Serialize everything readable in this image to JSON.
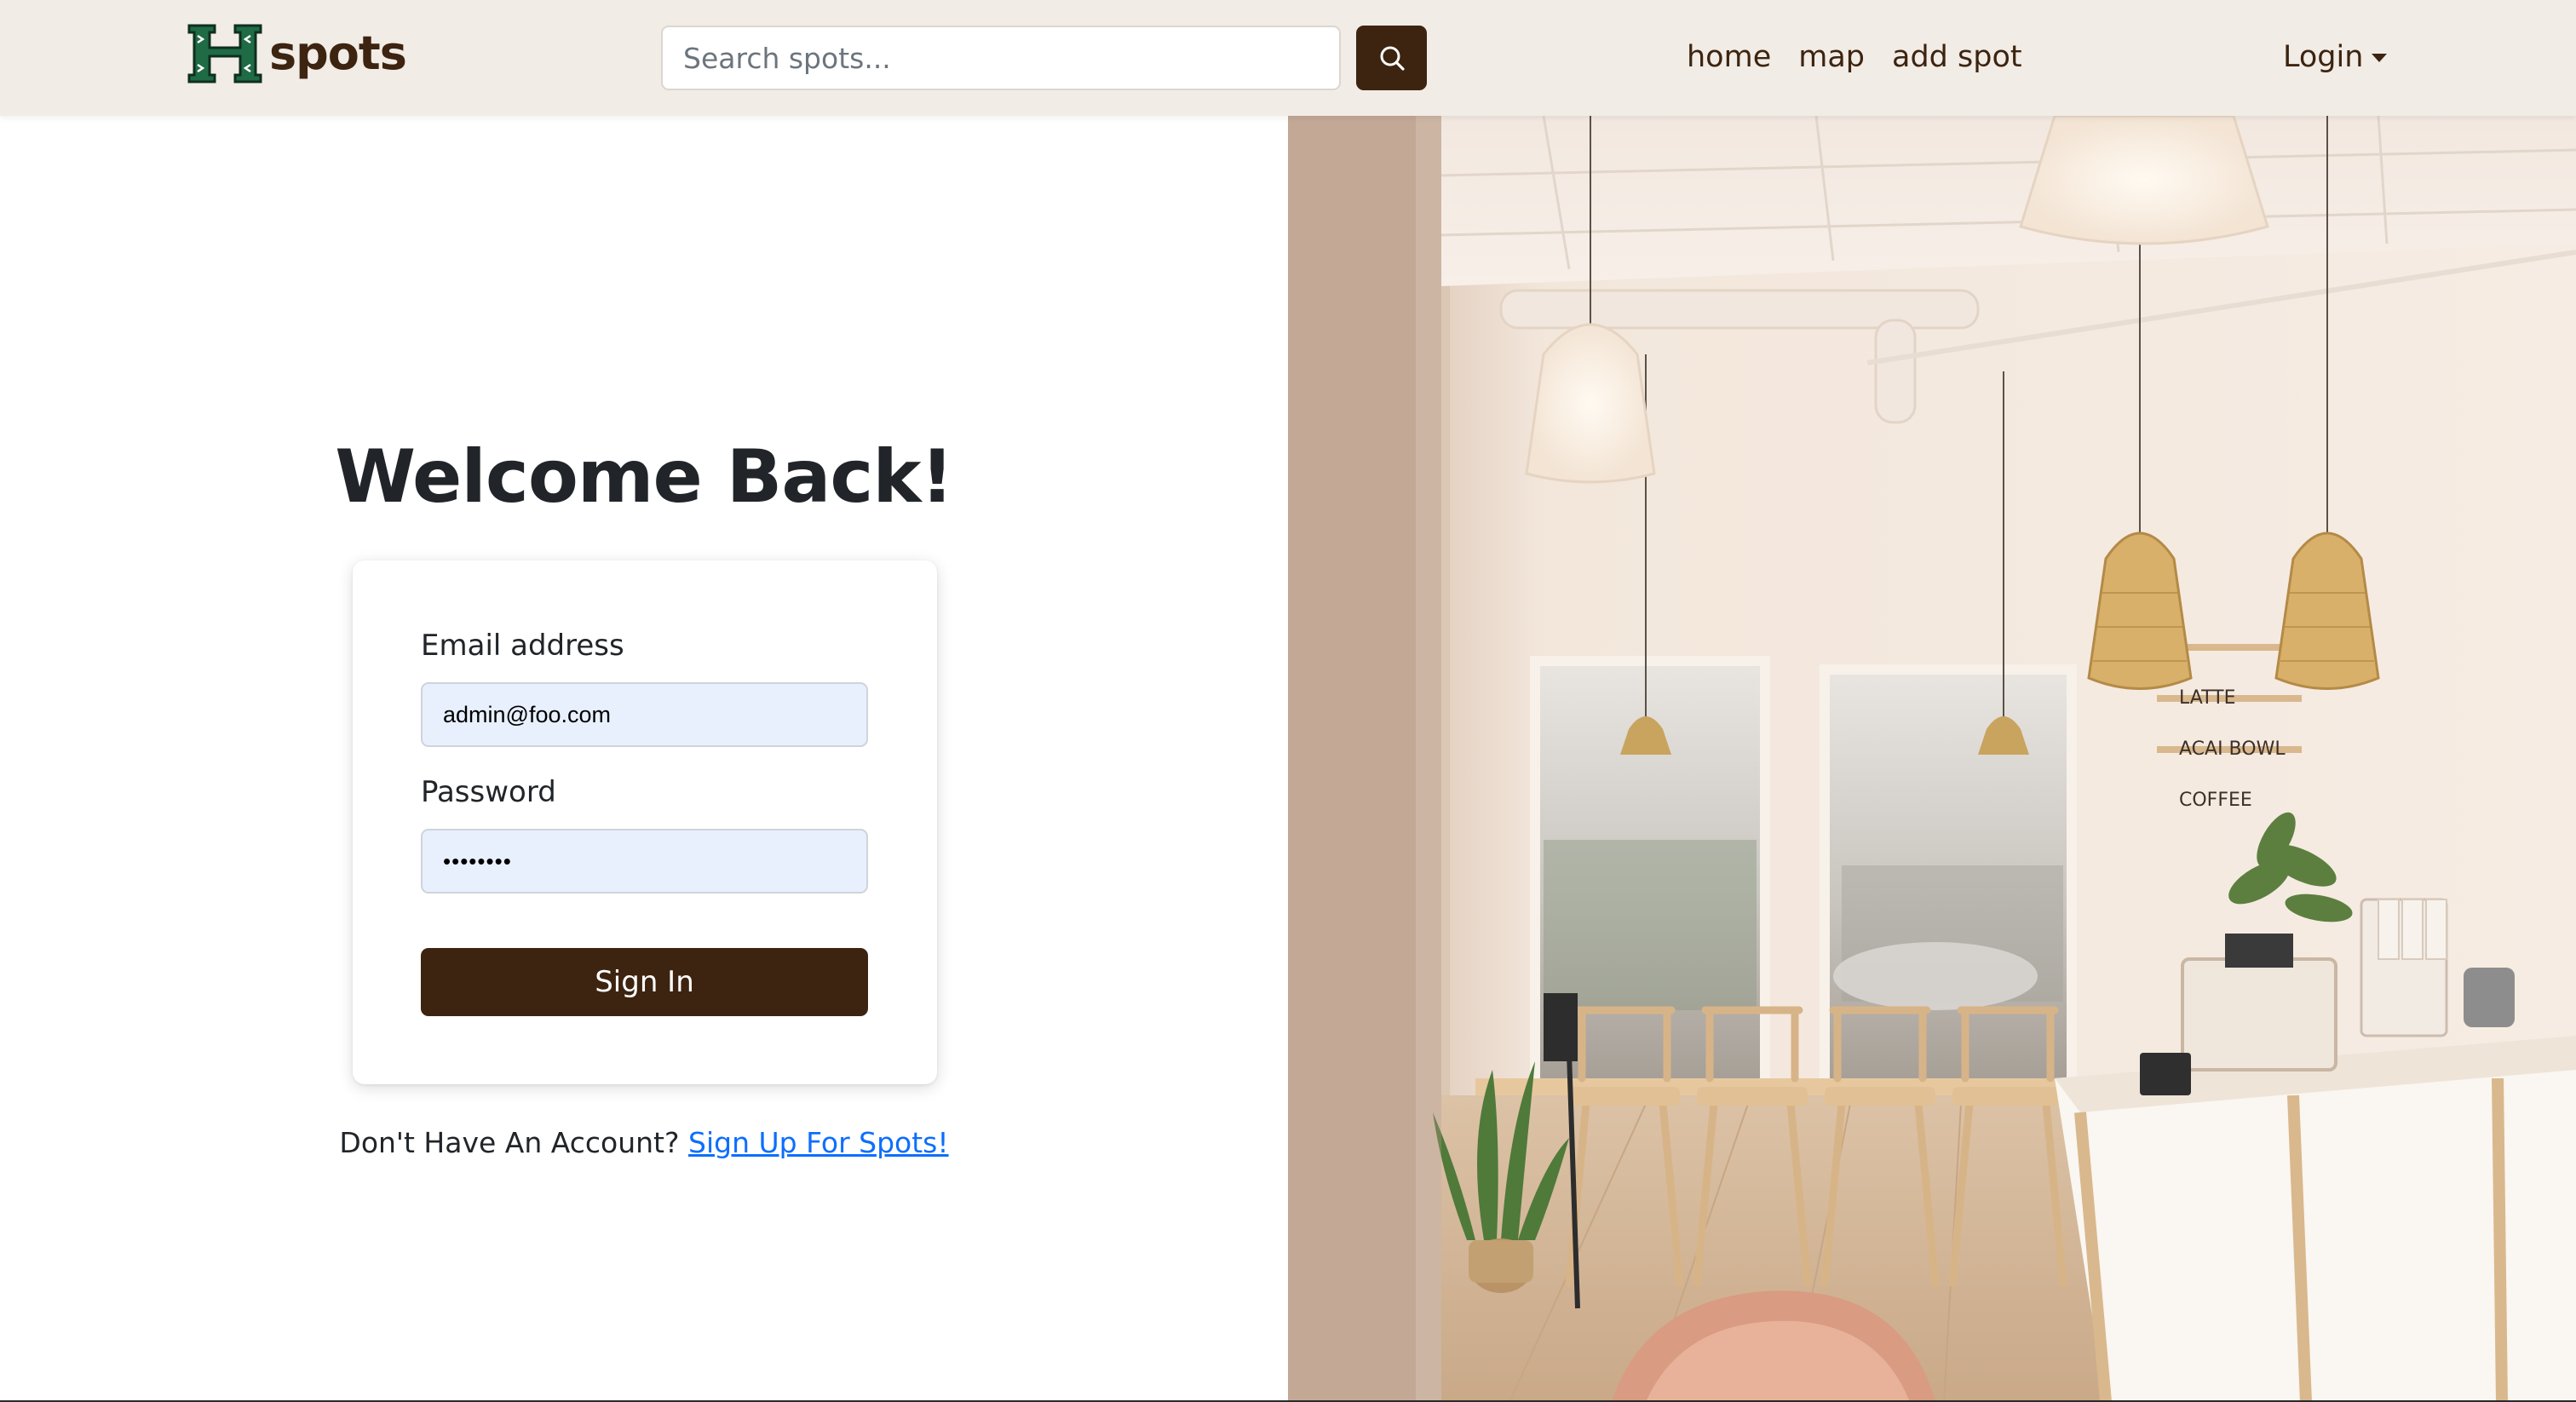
{
  "brand": {
    "logo_letter": "H",
    "name": "spots"
  },
  "search": {
    "placeholder": "Search spots..."
  },
  "nav": {
    "links": [
      {
        "label": "home"
      },
      {
        "label": "map"
      },
      {
        "label": "add spot"
      }
    ],
    "login_label": "Login"
  },
  "login": {
    "title": "Welcome Back!",
    "email_label": "Email address",
    "email_value": "admin@foo.com",
    "password_label": "Password",
    "password_value": "••••••••",
    "submit_label": "Sign In",
    "signup_prompt": "Don't Have An Account?",
    "signup_link": "Sign Up For Spots!"
  },
  "photo": {
    "menu_board": [
      "LATTE",
      "ACAI BOWL",
      "COFFEE"
    ]
  },
  "colors": {
    "brand_brown": "#3d2410",
    "navbar_bg": "#f1ece6",
    "autofill_bg": "#e8f0fe",
    "logo_green": "#1f6b46",
    "link_blue": "#0d6efd"
  }
}
